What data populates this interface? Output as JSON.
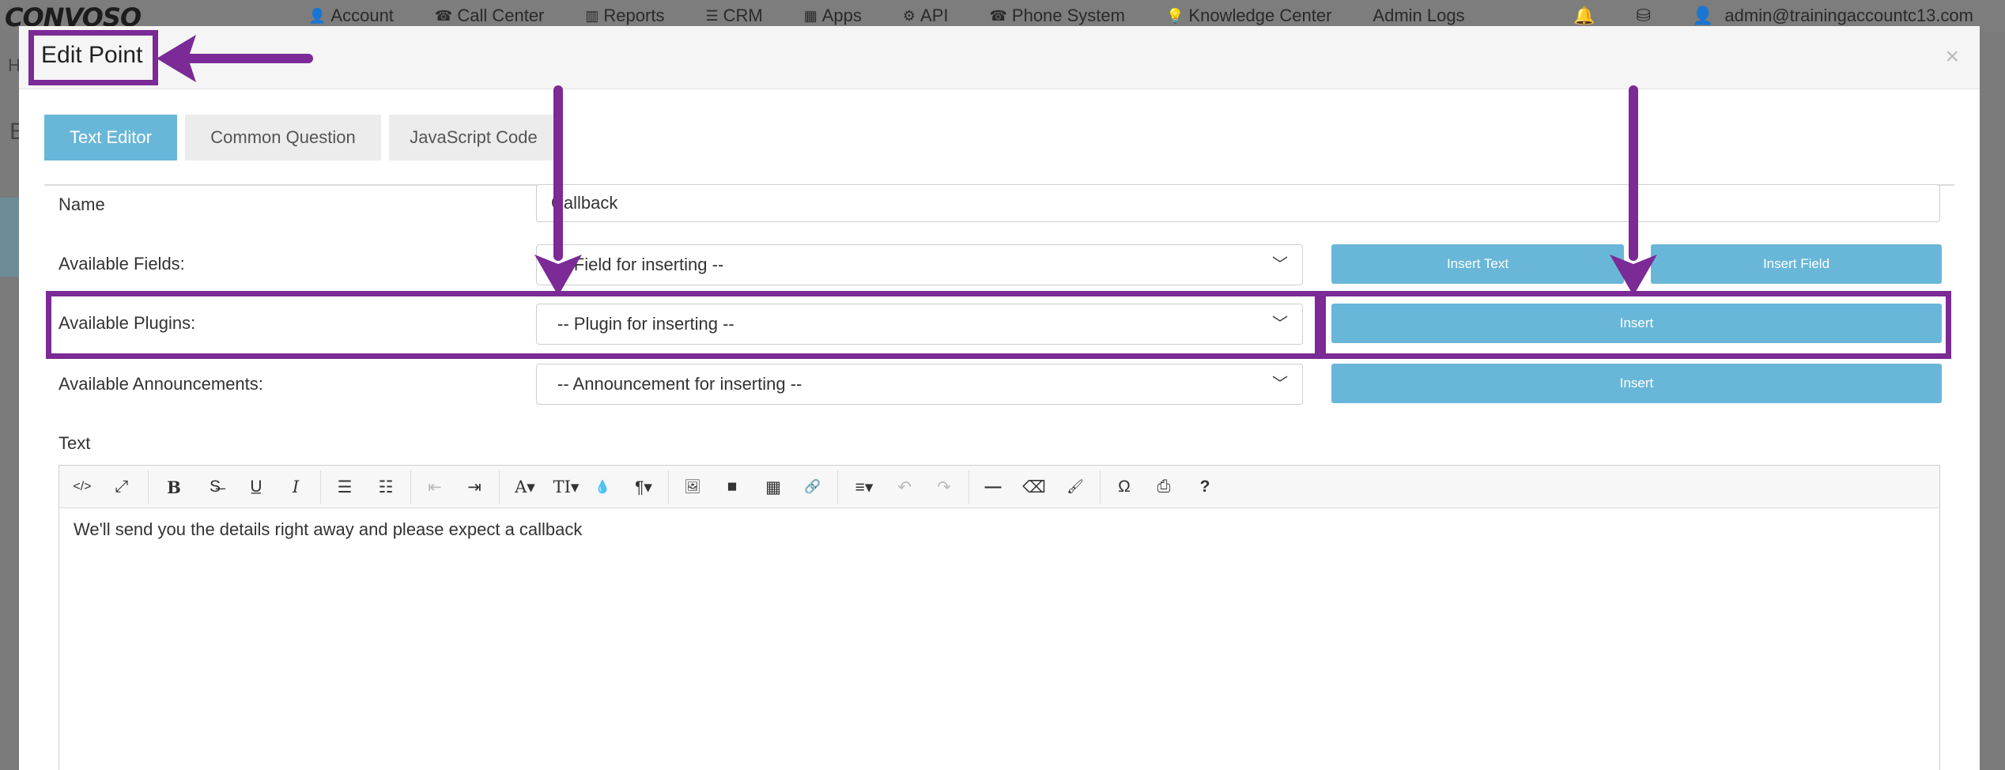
{
  "navbar": {
    "logo": "CONVOSO",
    "items": [
      {
        "icon": "user-icon",
        "glyph": "👤",
        "label": "Account"
      },
      {
        "icon": "phone-icon",
        "glyph": "☎",
        "label": "Call Center"
      },
      {
        "icon": "bar-chart-icon",
        "glyph": "▥",
        "label": "Reports"
      },
      {
        "icon": "list-icon",
        "glyph": "☰",
        "label": "CRM"
      },
      {
        "icon": "grid-icon",
        "glyph": "▦",
        "label": "Apps"
      },
      {
        "icon": "gear-icon",
        "glyph": "⚙",
        "label": "API"
      },
      {
        "icon": "phone-icon",
        "glyph": "☎",
        "label": "Phone System"
      },
      {
        "icon": "lightbulb-icon",
        "glyph": "💡",
        "label": "Knowledge Center"
      },
      {
        "icon": "",
        "glyph": "",
        "label": "Admin Logs"
      }
    ],
    "user_email": "admin@trainingaccountc13.com"
  },
  "background": {
    "breadcrumb_char": "H",
    "heading_char": "E"
  },
  "modal": {
    "title": "Edit Point",
    "close": "×",
    "tabs": [
      {
        "label": "Text Editor",
        "active": true
      },
      {
        "label": "Common Question",
        "active": false
      },
      {
        "label": "JavaScript Code",
        "active": false
      }
    ],
    "name_label": "Name",
    "name_value": "Callback",
    "fields_label": "Available Fields:",
    "fields_select": "-- Field for inserting --",
    "insert_text_button": "Insert Text",
    "insert_field_button": "Insert Field",
    "plugins_label": "Available Plugins:",
    "plugins_select": "-- Plugin for inserting --",
    "plugins_insert_button": "Insert",
    "announcements_label": "Available Announcements:",
    "announcements_select": "-- Announcement for inserting --",
    "announcements_insert_button": "Insert",
    "text_label": "Text",
    "editor_content": "We'll send you the details right away and please expect a callback"
  },
  "toolbar": [
    {
      "name": "code-view-icon",
      "glyph": "</>"
    },
    {
      "name": "fullscreen-icon",
      "glyph": "⤢"
    },
    {
      "name": "bold-icon",
      "glyph": "B"
    },
    {
      "name": "strikethrough-icon",
      "glyph": "S̶"
    },
    {
      "name": "underline-icon",
      "glyph": "U̲"
    },
    {
      "name": "italic-icon",
      "glyph": "I"
    },
    {
      "name": "bullet-list-icon",
      "glyph": "☰"
    },
    {
      "name": "numbered-list-icon",
      "glyph": "☷"
    },
    {
      "name": "outdent-icon",
      "glyph": "⇤"
    },
    {
      "name": "indent-icon",
      "glyph": "⇥"
    },
    {
      "name": "font-icon",
      "glyph": "A▾"
    },
    {
      "name": "font-size-icon",
      "glyph": "TI▾"
    },
    {
      "name": "color-icon",
      "glyph": "💧"
    },
    {
      "name": "paragraph-icon",
      "glyph": "¶▾"
    },
    {
      "name": "image-icon",
      "glyph": "🖼"
    },
    {
      "name": "video-icon",
      "glyph": "■"
    },
    {
      "name": "table-icon",
      "glyph": "▦"
    },
    {
      "name": "link-icon",
      "glyph": "🔗"
    },
    {
      "name": "align-icon",
      "glyph": "≡▾"
    },
    {
      "name": "undo-icon",
      "glyph": "↶"
    },
    {
      "name": "redo-icon",
      "glyph": "↷"
    },
    {
      "name": "horizontal-rule-icon",
      "glyph": "—"
    },
    {
      "name": "eraser-icon",
      "glyph": "⌫"
    },
    {
      "name": "format-painter-icon",
      "glyph": "🖌"
    },
    {
      "name": "special-char-icon",
      "glyph": "Ω"
    },
    {
      "name": "print-icon",
      "glyph": "⎙"
    },
    {
      "name": "help-icon",
      "glyph": "?"
    }
  ],
  "colors": {
    "accent": "#69b7d8",
    "annotation": "#7b2a96"
  }
}
